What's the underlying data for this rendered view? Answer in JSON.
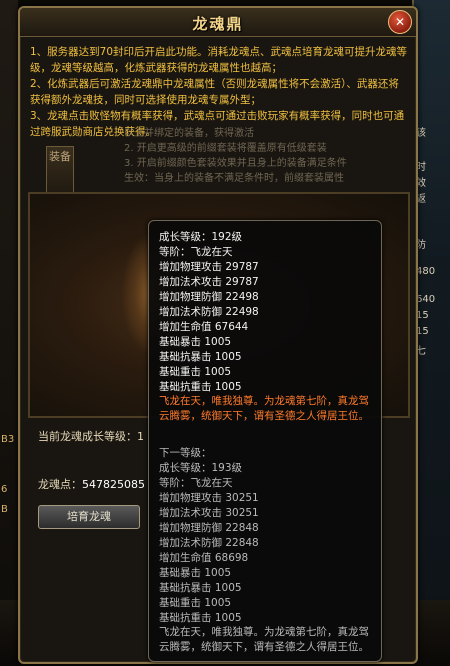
{
  "window": {
    "title": "龙魂鼎",
    "close_icon": "close-icon"
  },
  "description": [
    "1、服务器达到70封印后开启此功能。消耗龙魂点、武魂点培育龙魂可提升龙魂等级，龙魂等级越高，化炼武器获得的龙魂属性也越高；",
    "2、化炼武器后可激活龙魂鼎中龙魂属性（否则龙魂属性将不会激活）、武器还将获得额外龙魂技，同时可选择使用龙魂专属外型；",
    "3、龙魂点击败怪物有概率获得，武魂点可通过击败玩家有概率获得，同时也可通过跨服武勋商店兑换获得。"
  ],
  "side_tab": "装备",
  "background_text": [
    "以上并绑定的装备，获得激活",
    "2. 开启更高级的前缀套装将覆盖原有低级套装",
    "3. 开启前缀颜色套装效果并且身上的装备满足条件",
    "生效：当身上的装备不满足条件时，前缀套装属性"
  ],
  "growth_level_label": "当前龙魂成长等级：1",
  "points_label": "龙魂点：",
  "points_value": "547825085",
  "cultivate_button": "培育龙魂",
  "tooltip": {
    "current": {
      "growth": "成长等级：192级",
      "stage": "等阶：飞龙在天",
      "stats": [
        "增加物理攻击 29787",
        "增加法术攻击 29787",
        "增加物理防御 22498",
        "增加法术防御 22498",
        "增加生命值 67644",
        "基础暴击 1005",
        "基础抗暴击 1005",
        "基础重击 1005",
        "基础抗重击 1005"
      ],
      "desc": "飞龙在天，唯我独尊。为龙魂第七阶，真龙驾云腾雾，统御天下，谓有圣德之人得居王位。"
    },
    "next": {
      "header": "下一等级：",
      "growth": "成长等级：193级",
      "stage": "等阶：飞龙在天",
      "stats": [
        "增加物理攻击 30251",
        "增加法术攻击 30251",
        "增加物理防御 22848",
        "增加法术防御 22848",
        "增加生命值 68698",
        "基础暴击 1005",
        "基础抗暴击 1005",
        "基础重击 1005",
        "基础抗重击 1005"
      ],
      "desc": "飞龙在天，唯我独尊。为龙魂第七阶，真龙驾云腾雾，统御天下，谓有圣德之人得居王位。"
    }
  },
  "right_edge": [
    "该",
    "时",
    "效",
    "返",
    "防",
    "480",
    "640",
    "1",
    "15",
    "15",
    "七",
    "加成",
    "亿"
  ],
  "left_edge": [
    "B3",
    "6",
    "B"
  ],
  "colors": {
    "title": "#f3d48a",
    "desc": "#f0c040",
    "stage_desc": "#ff7a2c",
    "frame": "#8a7548"
  }
}
